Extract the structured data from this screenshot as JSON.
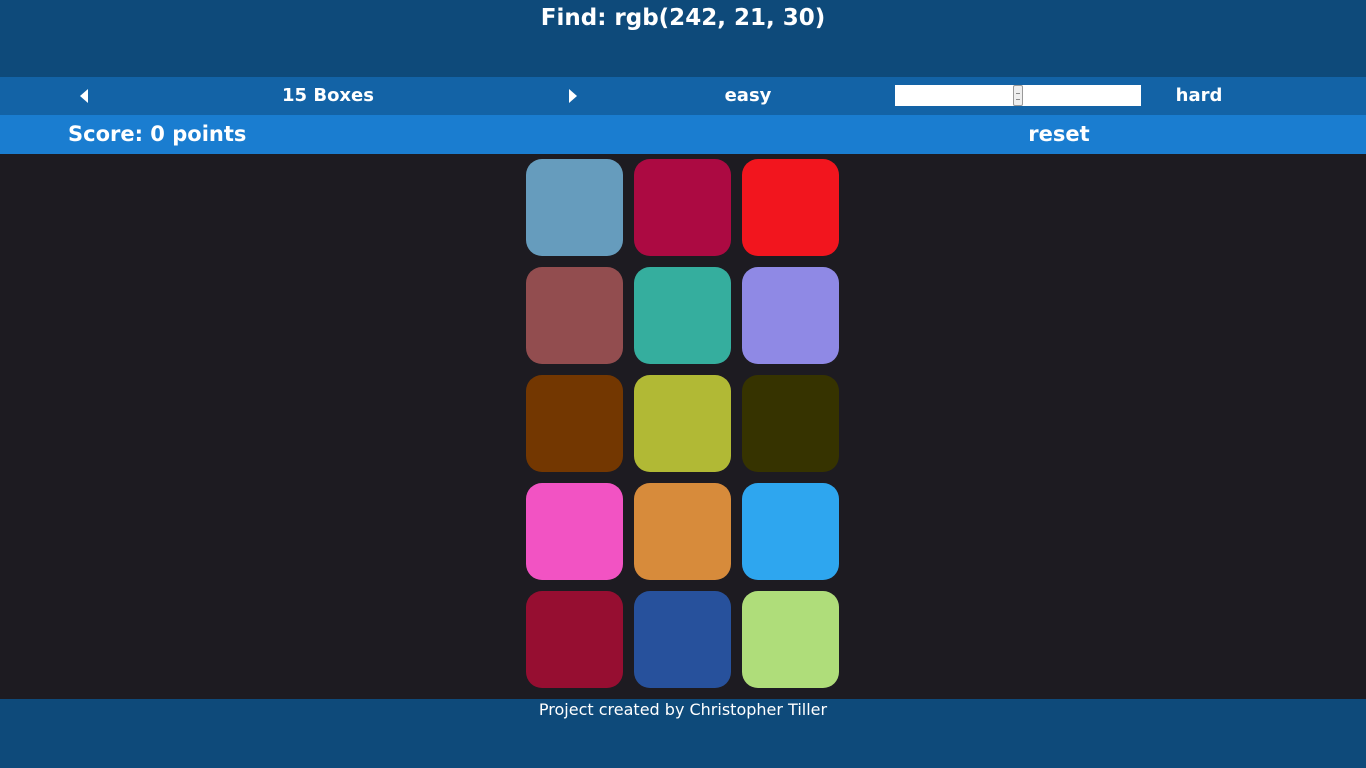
{
  "header": {
    "title": "Find: rgb(242, 21, 30)"
  },
  "controls": {
    "prev_icon": "triangle-left-icon",
    "boxes_label": "15 Boxes",
    "next_icon": "triangle-right-icon",
    "easy_label": "easy",
    "hard_label": "hard",
    "difficulty_value": 0.5
  },
  "scorebar": {
    "score_label": "Score: 0 points",
    "reset_label": "reset"
  },
  "boxes": [
    {
      "color": "#669cbd"
    },
    {
      "color": "#ac0a42"
    },
    {
      "color": "#f2151e"
    },
    {
      "color": "#924d4f"
    },
    {
      "color": "#35ae9e"
    },
    {
      "color": "#8f89e5"
    },
    {
      "color": "#733701"
    },
    {
      "color": "#b1b935"
    },
    {
      "color": "#363300"
    },
    {
      "color": "#f253c3"
    },
    {
      "color": "#d78b3b"
    },
    {
      "color": "#2ea6ef"
    },
    {
      "color": "#960e31"
    },
    {
      "color": "#27519c"
    },
    {
      "color": "#afdd7a"
    }
  ],
  "footer": {
    "credit": "Project created by Christopher Tiller"
  }
}
